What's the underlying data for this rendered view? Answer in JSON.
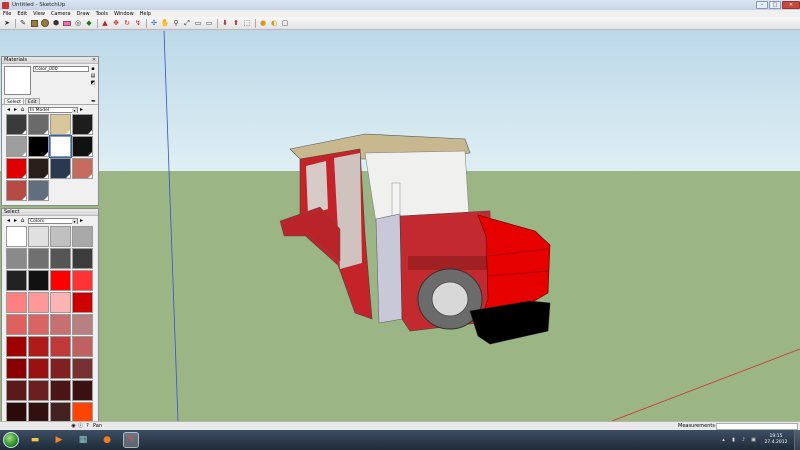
{
  "window": {
    "title": "Untitled - SketchUp"
  },
  "menu": [
    "File",
    "Edit",
    "View",
    "Camera",
    "Draw",
    "Tools",
    "Window",
    "Help"
  ],
  "toolbar": [
    "select-tool",
    "pencil-tool",
    "rectangle-tool",
    "circle-tool",
    "polygon-tool",
    "eraser-tool",
    "tape-tool",
    "paint-bucket-tool",
    "push-pull-tool",
    "move-tool",
    "rotate-tool",
    "offset-tool",
    "orbit-tool",
    "pan-tool",
    "zoom-tool",
    "zoom-extents-tool",
    "previous-view-tool",
    "next-view-tool",
    "get-models-tool",
    "share-model-tool",
    "components-tool",
    "google-earth-tool",
    "photo-texture-tool"
  ],
  "materials": {
    "title": "Materials",
    "name": "Color_000",
    "tab_select": "Select",
    "tab_edit": "Edit",
    "collection": "In Model",
    "swatches": [
      "#3a3a3a",
      "#6a6a6a",
      "#d8c79b",
      "#1d1d1d",
      "#9e9e9e",
      "#000000",
      "#ffffff",
      "#111111",
      "#e00000",
      "#2a1e1a",
      "#2b3950",
      "#c56a5e",
      "#b64a45",
      "#626d7d"
    ]
  },
  "colors": {
    "label": "Select",
    "collection": "Colors",
    "swatches": [
      "#ffffff",
      "#e0e0e0",
      "#c0c0c0",
      "#a8a8a8",
      "#8a8a8a",
      "#707070",
      "#555555",
      "#3c3c3c",
      "#222222",
      "#111111",
      "#ff0000",
      "#ff3333",
      "#ff8080",
      "#ff9999",
      "#ffb3b3",
      "#cc0000",
      "#e06060",
      "#d86464",
      "#c87070",
      "#b88080",
      "#a00000",
      "#b01a1a",
      "#c03a3a",
      "#c06060",
      "#880000",
      "#991111",
      "#802020",
      "#773030",
      "#5a1a1a",
      "#6a2020",
      "#4a1515",
      "#3a1010",
      "#2a0a0a",
      "#331010",
      "#442222",
      "#ff4400"
    ]
  },
  "status": {
    "text": "Pan",
    "measurements_label": "Measurements"
  },
  "taskbar": {
    "time": "19:15",
    "date": "27.4.2012"
  },
  "colors_theme": {
    "sky": "#cfe4ee",
    "ground": "#9cb584",
    "tractor_red": "#c5232a"
  }
}
